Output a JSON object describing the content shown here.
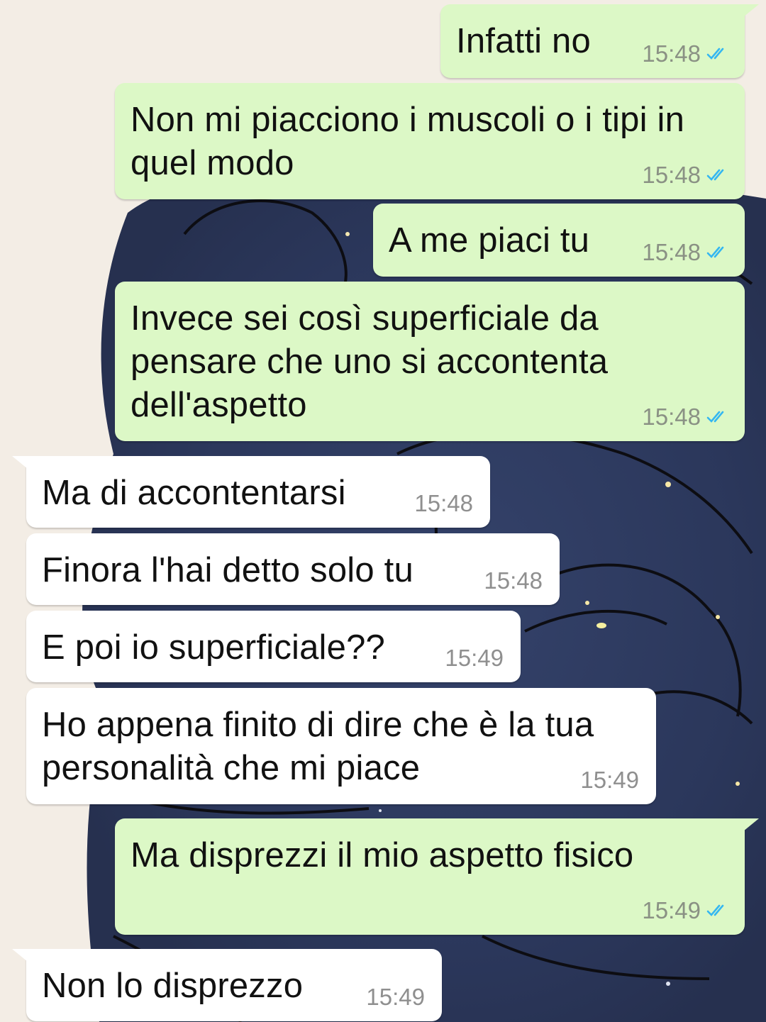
{
  "colors": {
    "outgoing_bubble": "#dcf8c6",
    "incoming_bubble": "#ffffff",
    "read_ticks": "#34b7f1",
    "wallpaper_light": "#f3ede5",
    "wallpaper_night": "#2d3a5e"
  },
  "messages": [
    {
      "direction": "outgoing",
      "text": "Infatti no",
      "time": "15:48",
      "status": "read-ticks-icon"
    },
    {
      "direction": "outgoing",
      "text": "Non mi piacciono i muscoli o i tipi in quel modo",
      "time": "15:48",
      "status": "read-ticks-icon"
    },
    {
      "direction": "outgoing",
      "text": "A me piaci tu",
      "time": "15:48",
      "status": "read-ticks-icon"
    },
    {
      "direction": "outgoing",
      "text": "Invece sei così superficiale da pensare che uno si accontenta dell'aspetto",
      "time": "15:48",
      "status": "read-ticks-icon"
    },
    {
      "direction": "incoming",
      "text": "Ma di accontentarsi",
      "time": "15:48"
    },
    {
      "direction": "incoming",
      "text": "Finora l'hai detto solo tu",
      "time": "15:48"
    },
    {
      "direction": "incoming",
      "text": "E poi io superficiale??",
      "time": "15:49"
    },
    {
      "direction": "incoming",
      "text": "Ho appena finito di dire che è la tua personalità che mi piace",
      "time": "15:49"
    },
    {
      "direction": "outgoing",
      "text": "Ma disprezzi il mio aspetto fisico",
      "time": "15:49",
      "status": "read-ticks-icon"
    },
    {
      "direction": "incoming",
      "text": "Non lo disprezzo",
      "time": "15:49"
    }
  ]
}
